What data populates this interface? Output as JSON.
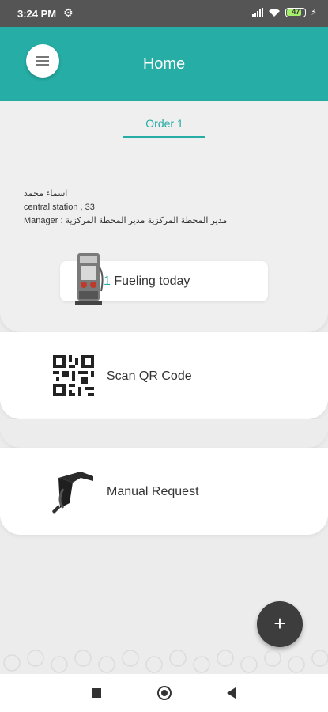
{
  "status_bar": {
    "time": "3:24 PM",
    "battery": "47",
    "icons": [
      "settings-icon",
      "signal-icon",
      "wifi-icon",
      "battery-icon",
      "charging-icon"
    ]
  },
  "header": {
    "title": "Home",
    "color": "#26ada5"
  },
  "tabs": [
    {
      "label": "Order 1",
      "active": true
    }
  ],
  "station": {
    "name": "اسماء محمد",
    "address": "central station , 33",
    "role": "Manager : مدير المحطة المركزية مدير المحطة المركزية"
  },
  "fueling": {
    "count": "1",
    "label": " Fueling today"
  },
  "actions": {
    "scan_label": "Scan QR Code",
    "manual_label": "Manual Request"
  },
  "fab": {
    "label": "+"
  },
  "nav": {
    "icons": [
      "recent-apps-icon",
      "home-icon",
      "back-icon"
    ]
  }
}
